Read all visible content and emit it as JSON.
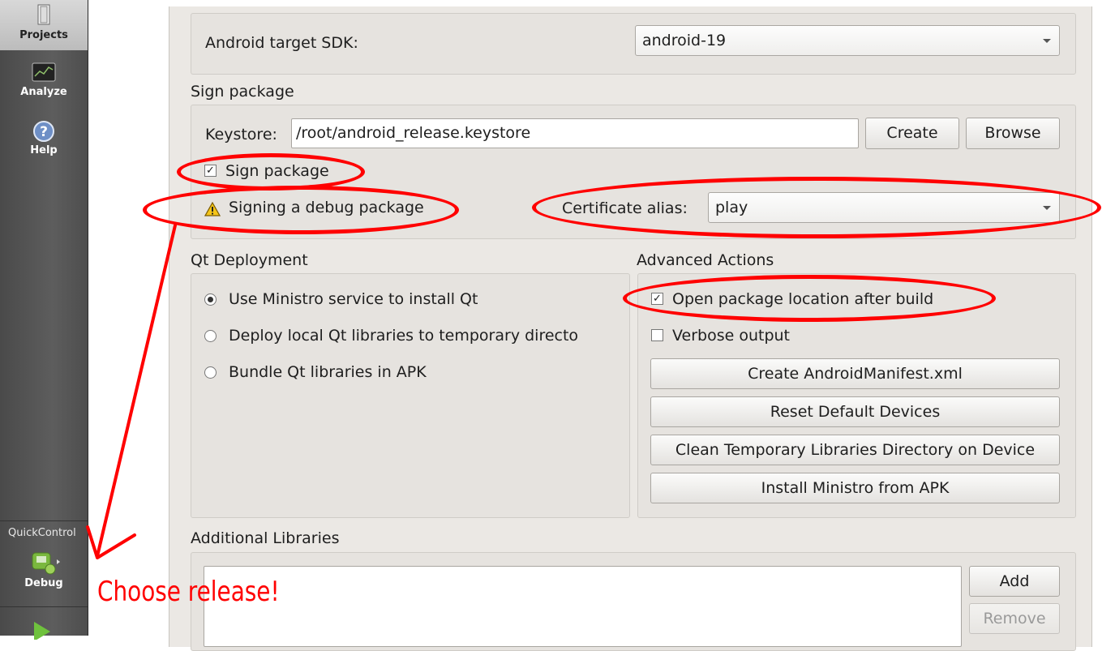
{
  "sidebar": {
    "modes": [
      {
        "label": "Projects",
        "icon": "projects-icon"
      },
      {
        "label": "Analyze",
        "icon": "analyze-icon"
      },
      {
        "label": "Help",
        "icon": "help-icon"
      }
    ],
    "quick_control": "QuickControl",
    "kit": {
      "label": "Debug",
      "icon": "android-kit-icon"
    },
    "run_icon": "run-icon"
  },
  "application": {
    "target_sdk_label": "Android target SDK:",
    "target_sdk_value": "android-19"
  },
  "sign": {
    "section_title": "Sign package",
    "keystore_label": "Keystore:",
    "keystore_value": "/root/android_release.keystore",
    "create_button": "Create",
    "browse_button": "Browse",
    "sign_checkbox_label": "Sign package",
    "sign_checked": true,
    "warning_text": "Signing a debug package",
    "cert_alias_label": "Certificate alias:",
    "cert_alias_value": "play"
  },
  "qt_deployment": {
    "title": "Qt Deployment",
    "options": [
      {
        "label": "Use Ministro service to install Qt",
        "selected": true
      },
      {
        "label": "Deploy local Qt libraries to temporary directo",
        "selected": false
      },
      {
        "label": "Bundle Qt libraries in APK",
        "selected": false
      }
    ]
  },
  "advanced": {
    "title": "Advanced Actions",
    "open_location_label": "Open package location after build",
    "open_location_checked": true,
    "verbose_label": "Verbose output",
    "verbose_checked": false,
    "buttons": [
      "Create AndroidManifest.xml",
      "Reset Default Devices",
      "Clean Temporary Libraries Directory on Device",
      "Install Ministro from APK"
    ]
  },
  "libraries": {
    "title": "Additional Libraries",
    "add_button": "Add",
    "remove_button": "Remove"
  },
  "annotation": {
    "text": "Choose release!",
    "color": "#ff0000"
  }
}
